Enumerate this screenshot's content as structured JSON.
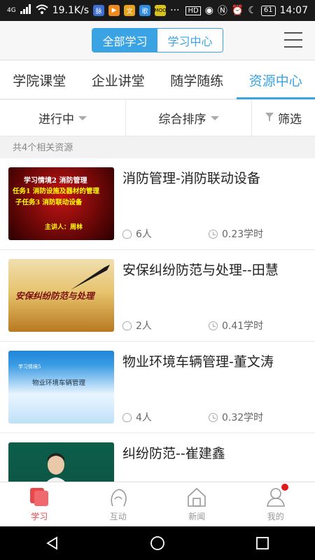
{
  "statusbar": {
    "network": "4G",
    "speed": "19.1K/s",
    "app_badges": [
      "脉",
      "▶",
      "文",
      "歌",
      "MOO"
    ],
    "more": "···",
    "battery": "61",
    "time": "14:07"
  },
  "header": {
    "seg_all": "全部学习",
    "seg_center": "学习中心"
  },
  "tabs": [
    "学院课堂",
    "企业讲堂",
    "随学随练",
    "资源中心"
  ],
  "filters": {
    "status": "进行中",
    "sort": "综合排序",
    "filter": "筛选"
  },
  "result_count": "共4个相关资源",
  "items": [
    {
      "title": "消防管理-消防联动设备",
      "people": "6人",
      "hours": "0.23学时",
      "thumb_lines": [
        "学习情境2 消防管理",
        "任务1 消防设施及器材的管理",
        "子任务3 消防联动设备",
        "主讲人：周林"
      ]
    },
    {
      "title": "安保纠纷防范与处理--田慧",
      "people": "2人",
      "hours": "0.41学时",
      "thumb_lines": [
        "安保纠纷防范与处理"
      ]
    },
    {
      "title": "物业环境车辆管理-董文涛",
      "people": "4人",
      "hours": "0.32学时",
      "thumb_lines": [
        "学习情境5",
        "物业环境车辆管理"
      ]
    },
    {
      "title": "纠纷防范--崔建鑫",
      "people": "",
      "hours": "",
      "thumb_lines": []
    }
  ],
  "bottomnav": [
    "学习",
    "互动",
    "新闻",
    "我的"
  ],
  "colors": {
    "accent": "#3aa3e3",
    "nav_active": "#e8484b"
  }
}
